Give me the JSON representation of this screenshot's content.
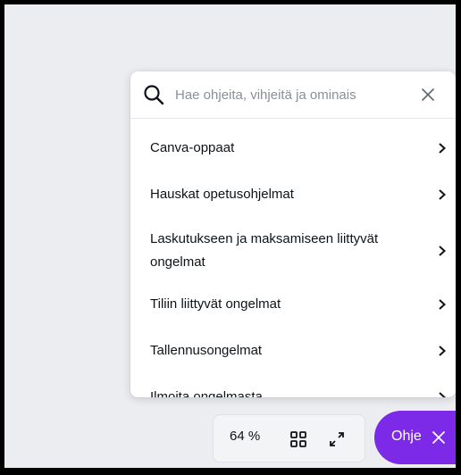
{
  "search": {
    "placeholder": "Hae ohjeita, vihjeitä ja ominais",
    "icon": "search-icon",
    "clear_icon": "close-icon"
  },
  "help_topics": [
    {
      "label": "Canva-oppaat"
    },
    {
      "label": "Hauskat opetusohjelmat"
    },
    {
      "label": "Laskutukseen ja maksamiseen liittyvät ongelmat"
    },
    {
      "label": "Tiliin liittyvät ongelmat"
    },
    {
      "label": "Tallennusongelmat"
    },
    {
      "label": "Ilmoita ongelmasta"
    }
  ],
  "toolbar": {
    "zoom_label": "64 %",
    "grid_icon": "grid-view-icon",
    "expand_icon": "fullscreen-icon"
  },
  "help_button": {
    "label": "Ohje",
    "icon": "close-icon"
  },
  "colors": {
    "accent": "#7c2ae8",
    "canvas_bg": "#ebedf1",
    "text": "#0e1318"
  }
}
